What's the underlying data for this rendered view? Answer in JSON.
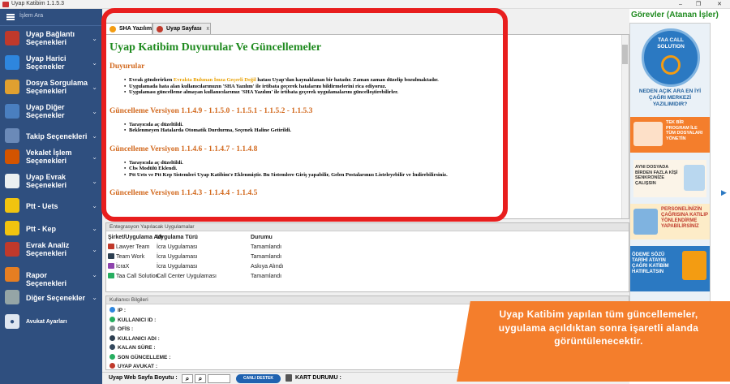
{
  "app": {
    "title": "Uyap Katibim 1.1.5.3"
  },
  "window_controls": {
    "minimize": "–",
    "restore": "❐",
    "close": "✕"
  },
  "sidebar": {
    "search_placeholder": "İşlem Ara",
    "items": [
      {
        "label": "Uyap Bağlantı Seçenekleri",
        "icon": "uyap-logo-icon",
        "color": "#c0392b"
      },
      {
        "label": "Uyap Harici Seçenekler",
        "icon": "question-icon",
        "color": "#2e86de"
      },
      {
        "label": "Dosya Sorgulama Seçenekleri",
        "icon": "folder-icon",
        "color": "#e0a030"
      },
      {
        "label": "Uyap Diğer Seçenekler",
        "icon": "grid-icon",
        "color": "#4a7fc0"
      },
      {
        "label": "Takip Seçenekleri",
        "icon": "checklist-icon",
        "color": "#6b8ab8"
      },
      {
        "label": "Vekalet İşlem Seçenekleri",
        "icon": "user-icon",
        "color": "#d35400"
      },
      {
        "label": "Uyap Evrak Seçenekleri",
        "icon": "document-icon",
        "color": "#ecf0f1"
      },
      {
        "label": "Ptt - Uets",
        "icon": "ptt-icon",
        "color": "#f1c40f"
      },
      {
        "label": "Ptt - Kep",
        "icon": "ptt-icon",
        "color": "#f1c40f"
      },
      {
        "label": "Evrak Analiz Seçenekleri",
        "icon": "analysis-icon",
        "color": "#c0392b"
      },
      {
        "label": "Rapor Seçenekleri",
        "icon": "report-icon",
        "color": "#e67e22"
      },
      {
        "label": "Diğer Seçenekler",
        "icon": "gear-icon",
        "color": "#95a5a6"
      }
    ],
    "settings_label": "Avukat Ayarları"
  },
  "tabs": [
    {
      "label": "SHA Yazılım",
      "active": true
    },
    {
      "label": "Uyap Sayfası",
      "active": false,
      "close": "x"
    }
  ],
  "document": {
    "title": "Uyap Katibim Duyurular Ve Güncellemeler",
    "sections": [
      {
        "heading": "Duyurular",
        "items": [
          {
            "pre": "Evrak gönderirken ",
            "highlight": "Evrakta Bulunan İmza Geçerli Değil",
            "post": " hatası Uyap'dan kaynaklanan bir hatadır. Zaman zaman düzelip bozulmaktadır."
          },
          {
            "pre": "Uygulamada hata alan kullanıcılarımızın 'SHA Yazılım' ile irtibata geçerek hatalarını bildirmelerini rica ediyoruz.",
            "highlight": "",
            "post": ""
          },
          {
            "pre": "Uygulaması güncelleme almayan kullanıcılarımız 'SHA Yazılım' ile irtibata geçerek uygulamalarını güncelleştirebilirler.",
            "highlight": "",
            "post": ""
          }
        ]
      },
      {
        "heading": "Güncelleme Versiyon 1.1.4.9 - 1.1.5.0 - 1.1.5.1 - 1.1.5.2 - 1.1.5.3",
        "items": [
          {
            "pre": "Tarayıcıda aç düzeltildi.",
            "highlight": "",
            "post": ""
          },
          {
            "pre": "Beklenmeyen Hatalarda Otomatik Durdurma, Seçenek Haline Getirildi.",
            "highlight": "",
            "post": ""
          }
        ]
      },
      {
        "heading": "Güncelleme Versiyon 1.1.4.6 - 1.1.4.7 - 1.1.4.8",
        "items": [
          {
            "pre": "Tarayıcıda aç düzeltildi.",
            "highlight": "",
            "post": ""
          },
          {
            "pre": "Cbs Modülü Eklendi.",
            "highlight": "",
            "post": ""
          },
          {
            "pre": "Ptt Uets ve Ptt Kep Sistemleri Uyap Katibim'e Eklenmiştir. Bu Sistemlere Giriş yapabilir, Gelen Postalarınızı Listeleyebilir ve İndirebilirsiniz.",
            "highlight": "",
            "post": ""
          }
        ]
      },
      {
        "heading": "Güncelleme Versiyon 1.1.4.3 - 1.1.4.4 - 1.1.4.5",
        "items": []
      }
    ]
  },
  "integrations": {
    "header": "Entegrasyon Yapılacak Uygulamalar",
    "columns": [
      "Şirket/Uygulama Adı",
      "Uygulama Türü",
      "Durumu"
    ],
    "rows": [
      {
        "name": "Lawyer Team",
        "type": "İcra Uygulaması",
        "status": "Tamamlandı",
        "logo": "#c0392b"
      },
      {
        "name": "Team Work",
        "type": "İcra Uygulaması",
        "status": "Tamamlandı",
        "logo": "#2c3e50"
      },
      {
        "name": "İcraX",
        "type": "İcra Uygulaması",
        "status": "Askıya Alındı",
        "logo": "#8e44ad"
      },
      {
        "name": "Taa Call Solution",
        "type": "Call Center Uygulaması",
        "status": "Tamamlandı",
        "logo": "#27ae60"
      }
    ]
  },
  "user_info": {
    "header": "Kullanıcı Bilgileri",
    "fields": [
      {
        "label": "IP :",
        "icon": "globe-icon",
        "color": "#2e86de"
      },
      {
        "label": "KULLANICI ID :",
        "icon": "id-icon",
        "color": "#27ae60"
      },
      {
        "label": "OFİS :",
        "icon": "office-icon",
        "color": "#7f8c8d"
      },
      {
        "label": "KULLANICI ADI :",
        "icon": "user-icon",
        "color": "#2c3e50"
      },
      {
        "label": "KALAN SÜRE :",
        "icon": "clock-icon",
        "color": "#34495e"
      },
      {
        "label": "SON GÜNCELLEME :",
        "icon": "update-icon",
        "color": "#27ae60"
      },
      {
        "label": "UYAP AVUKAT :",
        "icon": "uyap-icon",
        "color": "#c0392b"
      }
    ]
  },
  "status_bar": {
    "zoom_label": "Uyap Web Sayfa Boyutu :",
    "live_support": "CANLI DESTEK",
    "card_status": "KART DURUMU :"
  },
  "right_panel": {
    "header": "Görevler (Atanan İşler)",
    "ad": {
      "brand": "TAA CALL SOLUTION",
      "tagline": "NEDEN AÇIK ARA EN İYİ ÇAĞRI MERKEZİ YAZILIMIDIR?",
      "b1": "TEK BİR PROGRAM İLE TÜM DOSYALARI YÖNETİN",
      "b2": "AYNI DOSYADA BİRDEN FAZLA KİŞİ SENKRONİZE ÇALIŞSIN",
      "b3": "PERSONELİNİZİN ÇAĞRISINA KATILIP YÖNLENDİRME YAPABİLİRSİNİZ",
      "b4": "ÖDEME SÖZÜ TARİHİ ATAYIN ÇAĞRI KATİBİM HATIRLATSIN"
    },
    "arrow": "▶"
  },
  "callout": {
    "text": "Uyap Katibim yapılan tüm güncellemeler, uygulama açıldıktan sonra işaretli alanda görüntülenecektir."
  }
}
